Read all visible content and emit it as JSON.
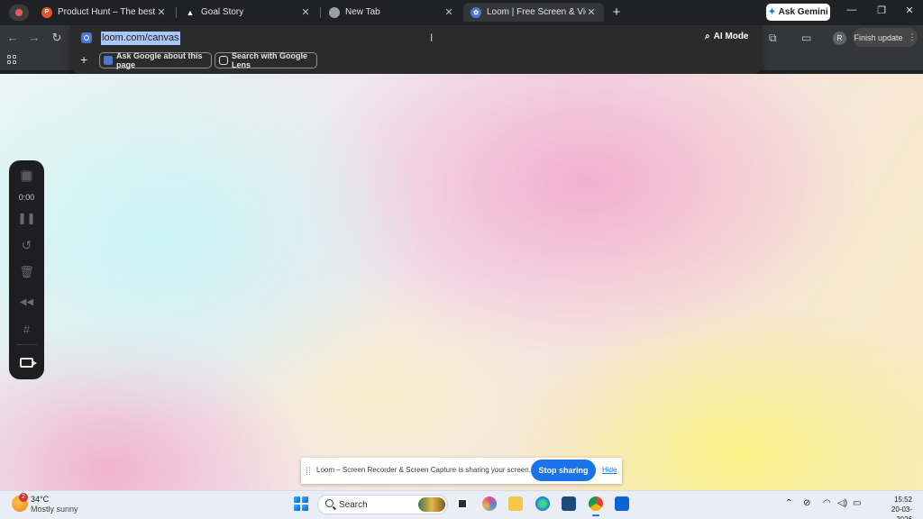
{
  "tabs": [
    {
      "title": "Product Hunt – The best new p",
      "favicon": "product-hunt-icon",
      "color": "#ea532a"
    },
    {
      "title": "Goal Story",
      "favicon": "goal-story-icon",
      "color": "#ffffff"
    },
    {
      "title": "New Tab",
      "favicon": "chrome-icon",
      "color": "#9aa0a6"
    },
    {
      "title": "Loom | Free Screen & Video Re",
      "favicon": "loom-icon",
      "color": "#4a77d4"
    }
  ],
  "ask_gemini": "Ask Gemini",
  "omnibox": {
    "url": "loom.com/canvas",
    "ai_mode": "AI Mode",
    "suggest_ask": "Ask Google about this page",
    "suggest_lens": "Search with Google Lens"
  },
  "finish_update": "Finish update",
  "profile_initial": "R",
  "loom": {
    "timer": "0:00",
    "share_text": "Loom – Screen Recorder & Screen Capture is sharing your screen.",
    "stop_sharing": "Stop sharing",
    "hide": "Hide"
  },
  "taskbar": {
    "weather_badge": "2",
    "temperature": "34°C",
    "condition": "Mostly sunny",
    "search_placeholder": "Search",
    "time": "15:52",
    "date": "20-03-2026"
  },
  "colors": {
    "accent": "#1a73e8",
    "chrome_dark": "#202124",
    "loom_bar": "#1e1e20"
  }
}
